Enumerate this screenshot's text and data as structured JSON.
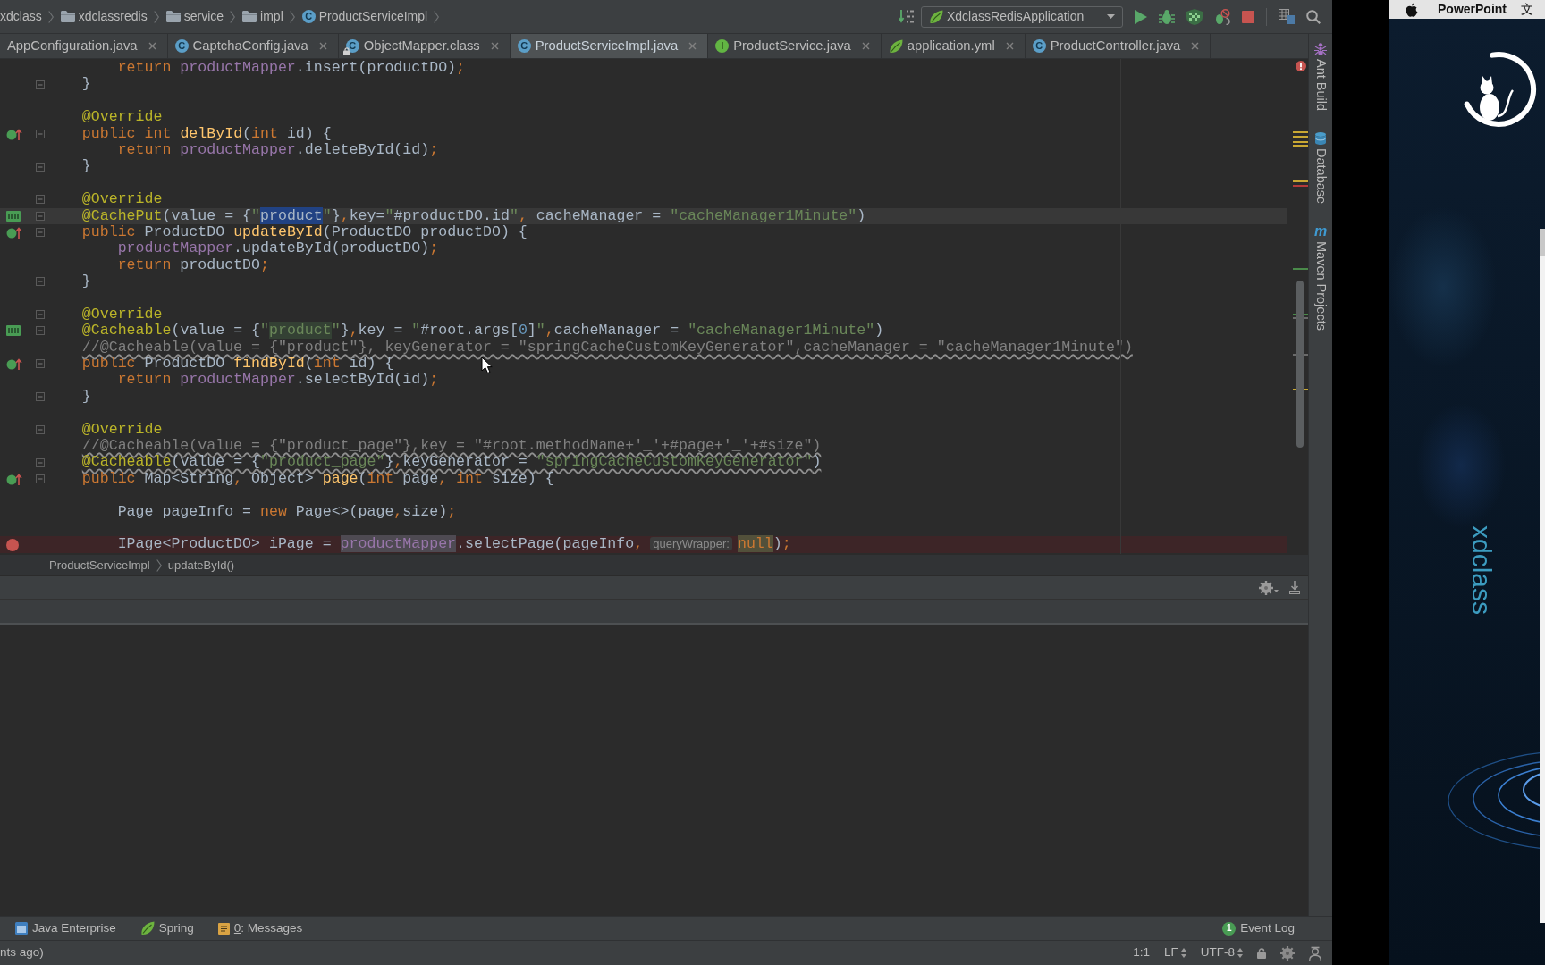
{
  "navigation_bar": {
    "breadcrumbs": [
      {
        "label": "xdclass"
      },
      {
        "label": "xdclassredis",
        "kind": "folder"
      },
      {
        "label": "service",
        "kind": "folder"
      },
      {
        "label": "impl",
        "kind": "folder"
      },
      {
        "label": "ProductServiceImpl",
        "kind": "class",
        "type_letter": "C"
      }
    ],
    "run_configuration": "XdclassRedisApplication"
  },
  "tabs": [
    {
      "label": "AppConfiguration.java",
      "selected": false
    },
    {
      "label": "CaptchaConfig.java",
      "kind": "class",
      "type_letter": "C",
      "selected": false
    },
    {
      "label": "ObjectMapper.class",
      "kind": "readonly",
      "type_letter": "C",
      "selected": false
    },
    {
      "label": "ProductServiceImpl.java",
      "kind": "class",
      "type_letter": "C",
      "selected": true
    },
    {
      "label": "ProductService.java",
      "kind": "interface",
      "type_letter": "I",
      "selected": false
    },
    {
      "label": "application.yml",
      "kind": "spring",
      "selected": false
    },
    {
      "label": "ProductController.java",
      "kind": "class",
      "type_letter": "C",
      "selected": false
    }
  ],
  "editor": {
    "lines": [
      {
        "tokens": [
          {
            "text": "        return",
            "kind": "keyword"
          },
          {
            "text": " productMapper",
            "kind": "field"
          },
          {
            "text": ".insert(productDO)",
            "kind": "plain"
          },
          {
            "text": ";",
            "kind": "keyword"
          }
        ],
        "fold": false,
        "warning": false,
        "current": false
      },
      {
        "tokens": [
          {
            "text": "    }",
            "kind": "plain"
          }
        ],
        "fold": true,
        "warning": false,
        "current": false
      },
      {
        "fold": false,
        "current": false
      },
      {
        "tokens": [
          {
            "text": "    @Override",
            "kind": "annotation"
          }
        ],
        "fold": false,
        "warning": false,
        "current": false
      },
      {
        "kind": "override",
        "tokens": [
          {
            "text": "    public",
            "kind": "keyword"
          },
          {
            "text": " int",
            "kind": "keyword"
          },
          {
            "text": " delById",
            "kind": "method"
          },
          {
            "text": "(",
            "kind": "plain"
          },
          {
            "text": "int",
            "kind": "keyword"
          },
          {
            "text": " id) {",
            "kind": "plain"
          }
        ],
        "fold": true,
        "warning": false,
        "current": false
      },
      {
        "tokens": [
          {
            "text": "        return",
            "kind": "keyword"
          },
          {
            "text": " productMapper",
            "kind": "field"
          },
          {
            "text": ".deleteById(id)",
            "kind": "plain"
          },
          {
            "text": ";",
            "kind": "keyword"
          }
        ],
        "fold": false,
        "warning": false,
        "current": false
      },
      {
        "tokens": [
          {
            "text": "    }",
            "kind": "plain"
          }
        ],
        "fold": true,
        "warning": false,
        "current": false
      },
      {
        "fold": false,
        "current": false
      },
      {
        "tokens": [
          {
            "text": "    @Override",
            "kind": "annotation"
          }
        ],
        "fold": true,
        "warning": false,
        "current": false
      },
      {
        "kind": "cache",
        "tokens": [
          {
            "text": "    @CachePut",
            "kind": "annotation"
          },
          {
            "text": "(value = {",
            "kind": "plain"
          },
          {
            "text": "\"",
            "kind": "string"
          },
          {
            "text": "product",
            "kind": "selected"
          },
          {
            "text": "\"",
            "kind": "string"
          },
          {
            "text": "}",
            "kind": "plain"
          },
          {
            "text": ",",
            "kind": "keyword"
          },
          {
            "text": "key=",
            "kind": "plain"
          },
          {
            "text": "\"",
            "kind": "string"
          },
          {
            "text": "#productDO.id",
            "kind": "plain"
          },
          {
            "text": "\"",
            "kind": "string"
          },
          {
            "text": ",",
            "kind": "keyword"
          },
          {
            "text": " cacheManager = ",
            "kind": "plain"
          },
          {
            "text": "\"cacheManager1Minute\"",
            "kind": "string"
          },
          {
            "text": ")",
            "kind": "plain"
          }
        ],
        "fold": true,
        "warning": false,
        "current": true
      },
      {
        "kind": "override",
        "tokens": [
          {
            "text": "    public",
            "kind": "keyword"
          },
          {
            "text": " ProductDO",
            "kind": "plain"
          },
          {
            "text": " updateById",
            "kind": "method"
          },
          {
            "text": "(ProductDO productDO) {",
            "kind": "plain"
          }
        ],
        "fold": true,
        "warning": false,
        "current": false
      },
      {
        "tokens": [
          {
            "text": "        productMapper",
            "kind": "field"
          },
          {
            "text": ".updateById(productDO)",
            "kind": "plain"
          },
          {
            "text": ";",
            "kind": "keyword"
          }
        ],
        "fold": false,
        "warning": false,
        "current": false
      },
      {
        "tokens": [
          {
            "text": "        return",
            "kind": "keyword"
          },
          {
            "text": " productDO",
            "kind": "plain"
          },
          {
            "text": ";",
            "kind": "keyword"
          }
        ],
        "fold": false,
        "warning": false,
        "current": false
      },
      {
        "tokens": [
          {
            "text": "    }",
            "kind": "plain"
          }
        ],
        "fold": true,
        "warning": false,
        "current": false
      },
      {
        "fold": false,
        "current": false
      },
      {
        "tokens": [
          {
            "text": "    @Override",
            "kind": "annotation"
          }
        ],
        "fold": true,
        "warning": false,
        "current": false
      },
      {
        "kind": "cache",
        "tokens": [
          {
            "text": "    @Cacheable",
            "kind": "annotation"
          },
          {
            "text": "(value = {",
            "kind": "plain"
          },
          {
            "text": "\"",
            "kind": "string"
          },
          {
            "text": "product",
            "kind": "matched"
          },
          {
            "text": "\"",
            "kind": "string"
          },
          {
            "text": "}",
            "kind": "plain"
          },
          {
            "text": ",",
            "kind": "keyword"
          },
          {
            "text": "key = ",
            "kind": "plain"
          },
          {
            "text": "\"",
            "kind": "string"
          },
          {
            "text": "#root.args[",
            "kind": "plain"
          },
          {
            "text": "0",
            "kind": "number"
          },
          {
            "text": "]",
            "kind": "plain"
          },
          {
            "text": "\"",
            "kind": "string"
          },
          {
            "text": ",",
            "kind": "keyword"
          },
          {
            "text": "cacheManager = ",
            "kind": "plain"
          },
          {
            "text": "\"cacheManager1Minute\"",
            "kind": "string"
          },
          {
            "text": ")",
            "kind": "plain"
          }
        ],
        "fold": true,
        "warning": false,
        "current": false
      },
      {
        "tokens": [
          {
            "text": "    //@Cacheable(value = {\"product\"}, keyGenerator = \"springCacheCustomKeyGenerator\",cacheManager = \"cacheManager1Minute\")",
            "kind": "comment"
          }
        ],
        "fold": false,
        "warning": true,
        "current": false
      },
      {
        "kind": "override",
        "tokens": [
          {
            "text": "    public",
            "kind": "keyword"
          },
          {
            "text": " ProductDO",
            "kind": "plain"
          },
          {
            "text": " findById",
            "kind": "method"
          },
          {
            "text": "(",
            "kind": "plain"
          },
          {
            "text": "int",
            "kind": "keyword"
          },
          {
            "text": " id) {",
            "kind": "plain"
          }
        ],
        "fold": true,
        "warning": false,
        "current": false
      },
      {
        "tokens": [
          {
            "text": "        return",
            "kind": "keyword"
          },
          {
            "text": " productMapper",
            "kind": "field"
          },
          {
            "text": ".selectById(id)",
            "kind": "plain"
          },
          {
            "text": ";",
            "kind": "keyword"
          }
        ],
        "fold": false,
        "warning": false,
        "current": false
      },
      {
        "tokens": [
          {
            "text": "    }",
            "kind": "plain"
          }
        ],
        "fold": true,
        "warning": false,
        "current": false
      },
      {
        "fold": false,
        "current": false
      },
      {
        "tokens": [
          {
            "text": "    @Override",
            "kind": "annotation"
          }
        ],
        "fold": true,
        "warning": false,
        "current": false
      },
      {
        "tokens": [
          {
            "text": "    //@Cacheable(value = {\"product_page\"},key = \"#root.methodName+'_'+#page+'_'+#size\")",
            "kind": "comment"
          }
        ],
        "fold": false,
        "warning": true,
        "current": false
      },
      {
        "tokens": [
          {
            "text": "    @Cacheable",
            "kind": "annotation"
          },
          {
            "text": "(value = {",
            "kind": "plain"
          },
          {
            "text": "\"product_page\"",
            "kind": "string"
          },
          {
            "text": "}",
            "kind": "plain"
          },
          {
            "text": ",",
            "kind": "keyword"
          },
          {
            "text": "keyGenerator = ",
            "kind": "plain"
          },
          {
            "text": "\"springCacheCustomKeyGenerator\"",
            "kind": "string"
          },
          {
            "text": ")",
            "kind": "plain"
          }
        ],
        "fold": true,
        "warning": true,
        "current": false
      },
      {
        "kind": "override",
        "tokens": [
          {
            "text": "    public",
            "kind": "keyword"
          },
          {
            "text": " Map<String",
            "kind": "plain"
          },
          {
            "text": ",",
            "kind": "keyword"
          },
          {
            "text": " Object>",
            "kind": "plain"
          },
          {
            "text": " page",
            "kind": "method"
          },
          {
            "text": "(",
            "kind": "plain"
          },
          {
            "text": "int",
            "kind": "keyword"
          },
          {
            "text": " page",
            "kind": "plain"
          },
          {
            "text": ",",
            "kind": "keyword"
          },
          {
            "text": " int",
            "kind": "keyword"
          },
          {
            "text": " size) {",
            "kind": "plain"
          }
        ],
        "fold": true,
        "warning": false,
        "current": false
      },
      {
        "fold": false,
        "current": false
      },
      {
        "tokens": [
          {
            "text": "        Page pageInfo = ",
            "kind": "plain"
          },
          {
            "text": "new",
            "kind": "keyword"
          },
          {
            "text": " Page<>(page",
            "kind": "plain"
          },
          {
            "text": ",",
            "kind": "keyword"
          },
          {
            "text": "size)",
            "kind": "plain"
          },
          {
            "text": ";",
            "kind": "keyword"
          }
        ],
        "fold": false,
        "warning": false,
        "current": false
      },
      {
        "fold": false,
        "current": false
      },
      {
        "kind": "breakpoint",
        "tokens": [
          {
            "text": "        IPage<ProductDO> iPage = ",
            "kind": "plain"
          },
          {
            "text": "productMapper",
            "kind": "fieldmatch"
          },
          {
            "text": ".selectPage(pageInfo",
            "kind": "plain"
          },
          {
            "text": ",",
            "kind": "keyword"
          },
          {
            "text": "queryWrapper:",
            "kind": "hint"
          },
          {
            "text": "null",
            "kind": "keywordmatch"
          },
          {
            "text": ")",
            "kind": "plain"
          },
          {
            "text": ";",
            "kind": "keyword"
          }
        ],
        "fold": false,
        "warning": false,
        "current": false
      }
    ],
    "breadcrumbs": [
      "ProductServiceImpl",
      "updateById()"
    ]
  },
  "tool_strip": [
    {
      "label": "Ant Build",
      "kind": "ant"
    },
    {
      "label": "Database",
      "kind": "database"
    },
    {
      "label": "Maven Projects",
      "kind": "maven",
      "type_letter": "m"
    }
  ],
  "tool_windows": [
    {
      "label": "Java Enterprise",
      "kind": "enterprise"
    },
    {
      "label": "Spring",
      "kind": "spring"
    },
    {
      "mnemonic": "0",
      "label": ": Messages",
      "kind": "messages"
    }
  ],
  "event_log": {
    "label": "Event Log",
    "count": "1"
  },
  "status_bar": {
    "message": "nts ago)",
    "caret_position": "1:1",
    "line_separator": "LF",
    "encoding": "UTF-8"
  },
  "desktop": {
    "menu_bar": {
      "app_name": "PowerPoint",
      "menu": "文"
    },
    "wallpaper_text": "xdclass"
  }
}
